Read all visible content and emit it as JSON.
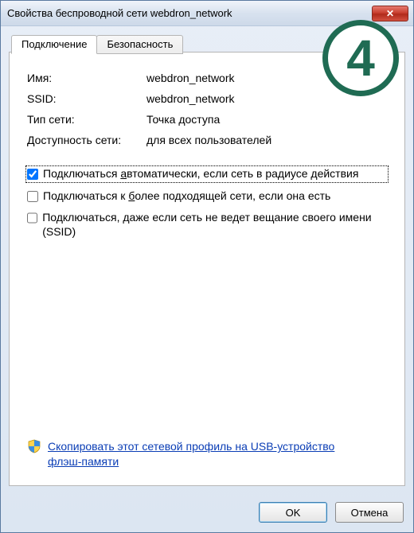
{
  "window": {
    "title": "Свойства беспроводной сети webdron_network",
    "close_symbol": "✕"
  },
  "tabs": {
    "connection": "Подключение",
    "security": "Безопасность"
  },
  "fields": {
    "name_label": "Имя:",
    "name_value": "webdron_network",
    "ssid_label": "SSID:",
    "ssid_value": "webdron_network",
    "type_label": "Тип сети:",
    "type_value": "Точка доступа",
    "avail_label": "Доступность сети:",
    "avail_value": "для всех пользователей"
  },
  "checks": {
    "auto_pre": "Подключаться ",
    "auto_u": "а",
    "auto_post": "втоматически, если сеть в радиусе действия",
    "better_pre": "Подключаться к ",
    "better_u": "б",
    "better_post": "олее подходящей сети, если она есть",
    "hidden": "Подключаться, даже если сеть не ведет вещание своего имени (SSID)"
  },
  "link": {
    "text": "Скопировать этот сетевой профиль на USB-устройство флэш-памяти"
  },
  "buttons": {
    "ok": "OK",
    "cancel": "Отмена"
  },
  "badge": {
    "number": "4"
  }
}
